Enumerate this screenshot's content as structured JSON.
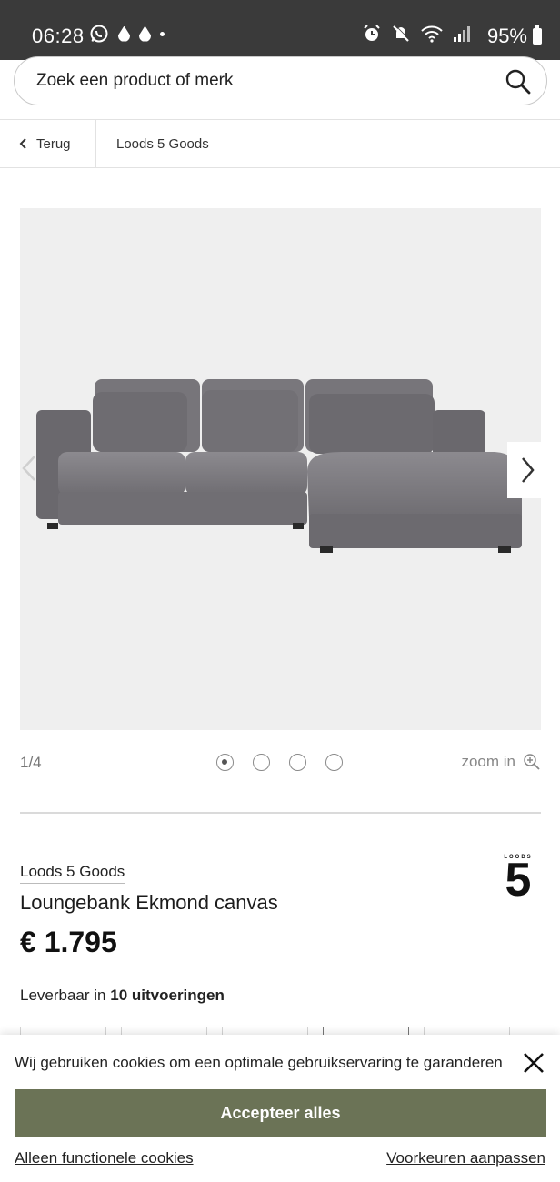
{
  "status_bar": {
    "time": "06:28",
    "battery": "95%",
    "left_icons": [
      "whatsapp-icon",
      "drop-icon",
      "drop-icon",
      "dot-icon"
    ],
    "right_icons": [
      "alarm-icon",
      "mute-icon",
      "wifi-icon",
      "signal-icon"
    ]
  },
  "search": {
    "placeholder": "Zoek een product of merk",
    "icon": "search-icon"
  },
  "breadcrumb": {
    "back_label": "Terug",
    "current": "Loods 5 Goods"
  },
  "gallery": {
    "counter": "1/4",
    "dots_total": 4,
    "active_dot": 1,
    "zoom_label": "zoom in",
    "image": "grey-corner-sofa-image"
  },
  "product": {
    "brand": "Loods 5 Goods",
    "name": "Loungebank Ekmond canvas",
    "price": "€ 1.795",
    "availability_prefix": "Leverbaar in",
    "availability_count": "10 uitvoeringen",
    "logo": "loods5-logo",
    "logo_text": "LOODS",
    "logo_digit": "5"
  },
  "cookie_banner": {
    "message": "Wij gebruiken cookies om een optimale gebruikservaring te garanderen",
    "accept_label": "Accepteer alles",
    "functional_label": "Alleen functionele cookies",
    "preferences_label": "Voorkeuren aanpassen"
  },
  "colors": {
    "status_bar_bg": "#3a3a3a",
    "accept_button": "#6b7356",
    "gallery_bg": "#efefef"
  }
}
